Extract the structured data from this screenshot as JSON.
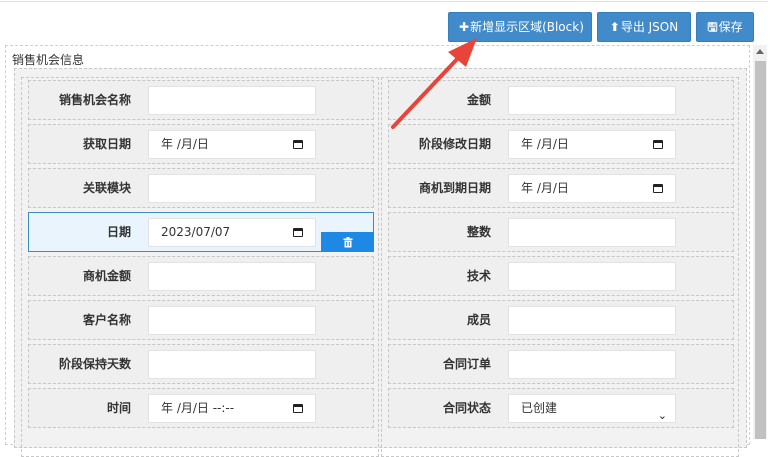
{
  "toolbar": {
    "add_icon": "✚",
    "add_label": "新增显示区域(Block)",
    "export_icon": "⬆",
    "export_label": "导出 JSON",
    "save_icon": "🖫",
    "save_label": "保存"
  },
  "panel": {
    "title": "销售机会信息"
  },
  "left_rows": [
    {
      "label": "销售机会名称",
      "value": "",
      "type": "text"
    },
    {
      "label": "获取日期",
      "value": "年 /月/日",
      "type": "date"
    },
    {
      "label": "关联模块",
      "value": "",
      "type": "text"
    },
    {
      "label": "日期",
      "value": "2023/07/07",
      "type": "date",
      "selected": true
    },
    {
      "label": "商机金额",
      "value": "",
      "type": "text"
    },
    {
      "label": "客户名称",
      "value": "",
      "type": "text"
    },
    {
      "label": "阶段保持天数",
      "value": "",
      "type": "text"
    },
    {
      "label": "时间",
      "value": "年 /月/日  --:--",
      "type": "datetime"
    }
  ],
  "right_rows": [
    {
      "label": "金额",
      "value": "",
      "type": "text"
    },
    {
      "label": "阶段修改日期",
      "value": "年 /月/日",
      "type": "date"
    },
    {
      "label": "商机到期日期",
      "value": "年 /月/日",
      "type": "date"
    },
    {
      "label": "整数",
      "value": "",
      "type": "text"
    },
    {
      "label": "技术",
      "value": "",
      "type": "text"
    },
    {
      "label": "成员",
      "value": "",
      "type": "text"
    },
    {
      "label": "合同订单",
      "value": "",
      "type": "text"
    },
    {
      "label": "合同状态",
      "value": "已创建",
      "type": "select"
    }
  ],
  "icons": {
    "trash": "trash-icon",
    "calendar": "calendar-icon",
    "dropdown": "chevron-down-icon"
  },
  "colors": {
    "primary_button": "#428bca",
    "selected_border": "#3c8dbc",
    "trash_button": "#1e88e5",
    "annotation_arrow": "#e8443a"
  }
}
